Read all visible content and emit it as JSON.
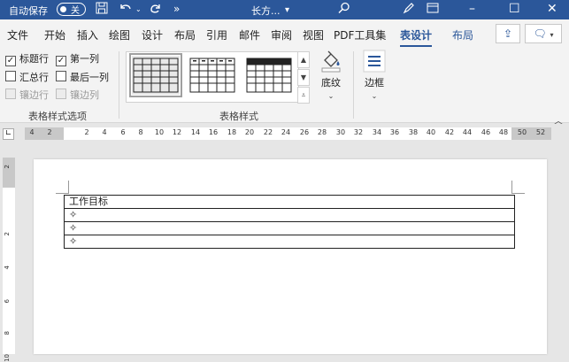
{
  "titlebar": {
    "autosave_label": "自动保存",
    "autosave_state": "关",
    "doc_name": "长方...",
    "buttons": [
      "save-icon",
      "undo-icon",
      "redo-icon",
      "more-icon"
    ],
    "window_controls": [
      "ribbon-display-icon",
      "minimize-icon",
      "maximize-icon",
      "close-icon"
    ]
  },
  "tabs": [
    {
      "label": "文件"
    },
    {
      "label": "开始"
    },
    {
      "label": "插入"
    },
    {
      "label": "绘图"
    },
    {
      "label": "设计"
    },
    {
      "label": "布局"
    },
    {
      "label": "引用"
    },
    {
      "label": "邮件"
    },
    {
      "label": "审阅"
    },
    {
      "label": "视图"
    },
    {
      "label": "PDF工具集"
    },
    {
      "label": "表设计",
      "active": true
    },
    {
      "label": "布局",
      "contextual": true
    }
  ],
  "table_style_options": {
    "items": [
      {
        "label": "标题行",
        "checked": true,
        "enabled": true
      },
      {
        "label": "第一列",
        "checked": true,
        "enabled": true
      },
      {
        "label": "汇总行",
        "checked": false,
        "enabled": true
      },
      {
        "label": "最后一列",
        "checked": false,
        "enabled": true
      },
      {
        "label": "镶边行",
        "checked": false,
        "enabled": false
      },
      {
        "label": "镶边列",
        "checked": false,
        "enabled": false
      }
    ],
    "group_label": "表格样式选项"
  },
  "table_styles": {
    "group_label": "表格样式",
    "thumb_count": 3
  },
  "shading": {
    "label": "底纹"
  },
  "borders": {
    "label": "边框"
  },
  "ruler": {
    "marks": [
      "4",
      "2",
      "2",
      "4",
      "6",
      "8",
      "10",
      "12",
      "14",
      "16",
      "18",
      "20",
      "22",
      "24",
      "26",
      "28",
      "30",
      "32",
      "34",
      "36",
      "38",
      "40",
      "42",
      "44",
      "46",
      "48",
      "50",
      "52"
    ]
  },
  "vruler": {
    "marks": [
      "2",
      "2",
      "4",
      "6",
      "8",
      "10"
    ]
  },
  "document": {
    "table_rows": [
      {
        "text": "工作目标"
      },
      {
        "text": "✧"
      },
      {
        "text": "✧"
      },
      {
        "text": "✧"
      }
    ]
  },
  "colors": {
    "brand": "#2b579a",
    "ribbon_bg": "#f3f3f3"
  }
}
